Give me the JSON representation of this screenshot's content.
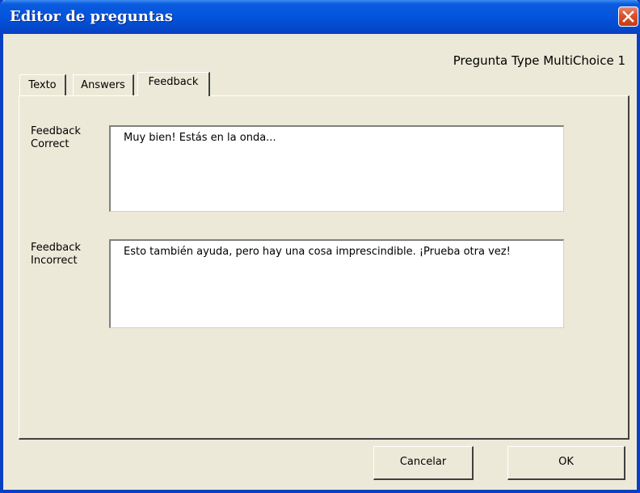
{
  "window": {
    "title": "Editor de preguntas",
    "subtitle": "Pregunta Type MultiChoice 1"
  },
  "tabs": [
    {
      "label": "Texto",
      "active": false
    },
    {
      "label": "Answers",
      "active": false
    },
    {
      "label": "Feedback",
      "active": true
    }
  ],
  "fields": {
    "correct": {
      "label_line1": "Feedback",
      "label_line2": "Correct",
      "value": "Muy bien! Estás en la onda..."
    },
    "incorrect": {
      "label_line1": "Feedback",
      "label_line2": "Incorrect",
      "value": "Esto también ayuda, pero hay una cosa imprescindible. ¡Prueba otra vez!"
    }
  },
  "buttons": {
    "cancel_label": "Cancelar",
    "ok_label": "OK"
  },
  "colors": {
    "titlebar": "#0554dc",
    "close_button": "#d9502c",
    "dialog_bg": "#ece9d8"
  },
  "icons": {
    "close": "close-icon"
  }
}
